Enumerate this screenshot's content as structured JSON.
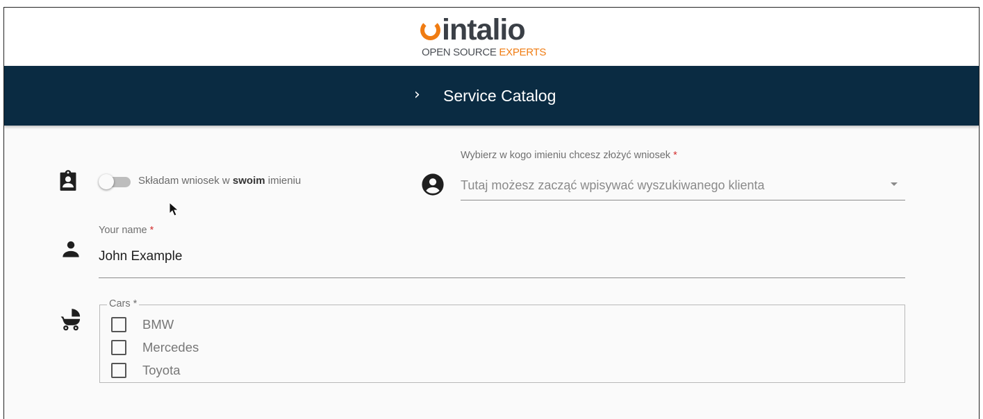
{
  "brand": {
    "word": "intalio",
    "tag_plain": "OPEN SOURCE ",
    "tag_accent": "EXPERTS",
    "accent_color": "#f07c12"
  },
  "nav": {
    "chevron_icon": "chevron-right-icon",
    "title": "Service Catalog",
    "background": "#0a2b42"
  },
  "form": {
    "toggle": {
      "icon": "clipboard-account-icon",
      "label_prefix": "Składam wniosek w ",
      "label_bold": "swoim",
      "label_suffix": " imieniu",
      "checked": false
    },
    "client_select": {
      "icon": "account-circle-icon",
      "label": "Wybierz w kogo imieniu chcesz złożyć wniosek",
      "required_mark": "*",
      "placeholder": "Tutaj możesz zacząć wpisywać wyszukiwanego klienta"
    },
    "name": {
      "icon": "person-icon",
      "label": "Your name",
      "required_mark": "*",
      "value": "John Example"
    },
    "cars": {
      "icon": "baby-carriage-icon",
      "legend": "Cars *",
      "options": [
        {
          "label": "BMW",
          "checked": false
        },
        {
          "label": "Mercedes",
          "checked": false
        },
        {
          "label": "Toyota",
          "checked": false
        }
      ]
    }
  }
}
